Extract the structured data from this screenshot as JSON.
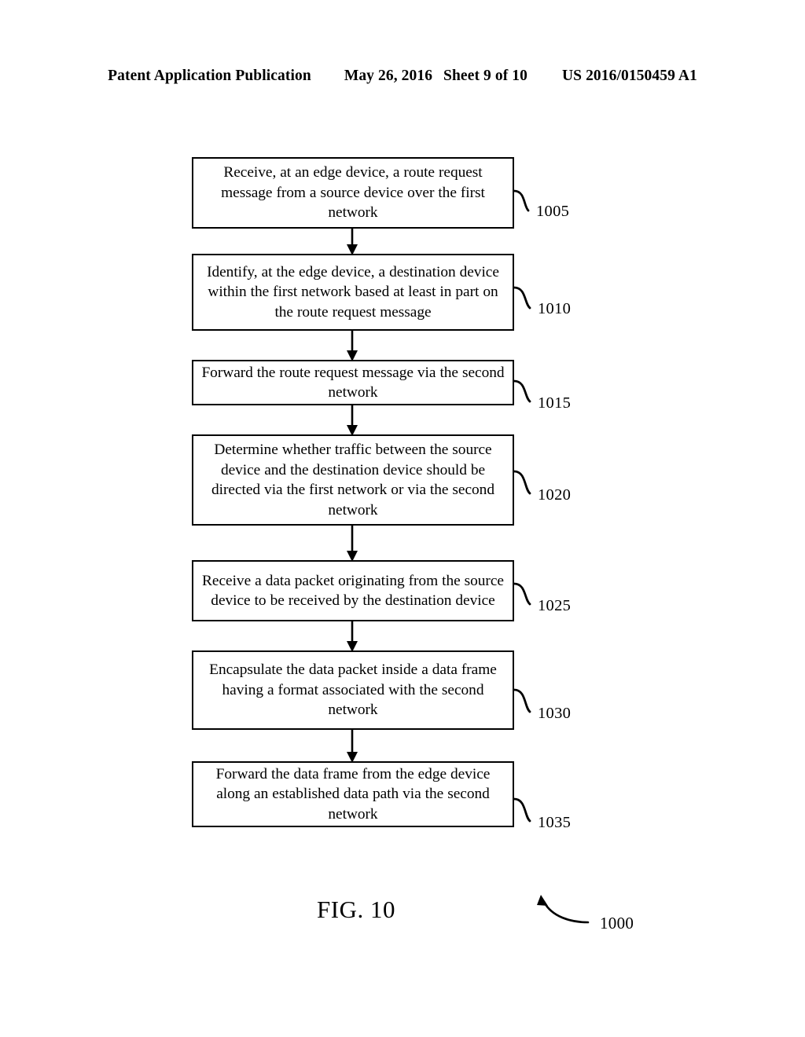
{
  "header": {
    "publication": "Patent Application Publication",
    "date": "May 26, 2016",
    "sheet": "Sheet 9 of 10",
    "document_number": "US 2016/0150459 A1"
  },
  "figure": {
    "caption": "FIG. 10",
    "overall_ref": "1000"
  },
  "flowchart": {
    "type": "vertical-flowchart",
    "steps": [
      {
        "ref": "1005",
        "text": "Receive, at an edge device, a route request message from a source device over the first network"
      },
      {
        "ref": "1010",
        "text": "Identify, at the edge device, a destination device within the first network based at least in part on the route request message"
      },
      {
        "ref": "1015",
        "text": "Forward the route request message via the second network"
      },
      {
        "ref": "1020",
        "text": "Determine whether traffic between the source device and the destination device should be directed via the first network or via the second network"
      },
      {
        "ref": "1025",
        "text": "Receive a data packet originating from the source device to be received by the destination device"
      },
      {
        "ref": "1030",
        "text": "Encapsulate the data packet inside a data frame having a format associated with the second network"
      },
      {
        "ref": "1035",
        "text": "Forward the data frame from the edge device along an established data path via the second network"
      }
    ]
  },
  "colors": {
    "ink": "#000000",
    "page": "#ffffff"
  }
}
